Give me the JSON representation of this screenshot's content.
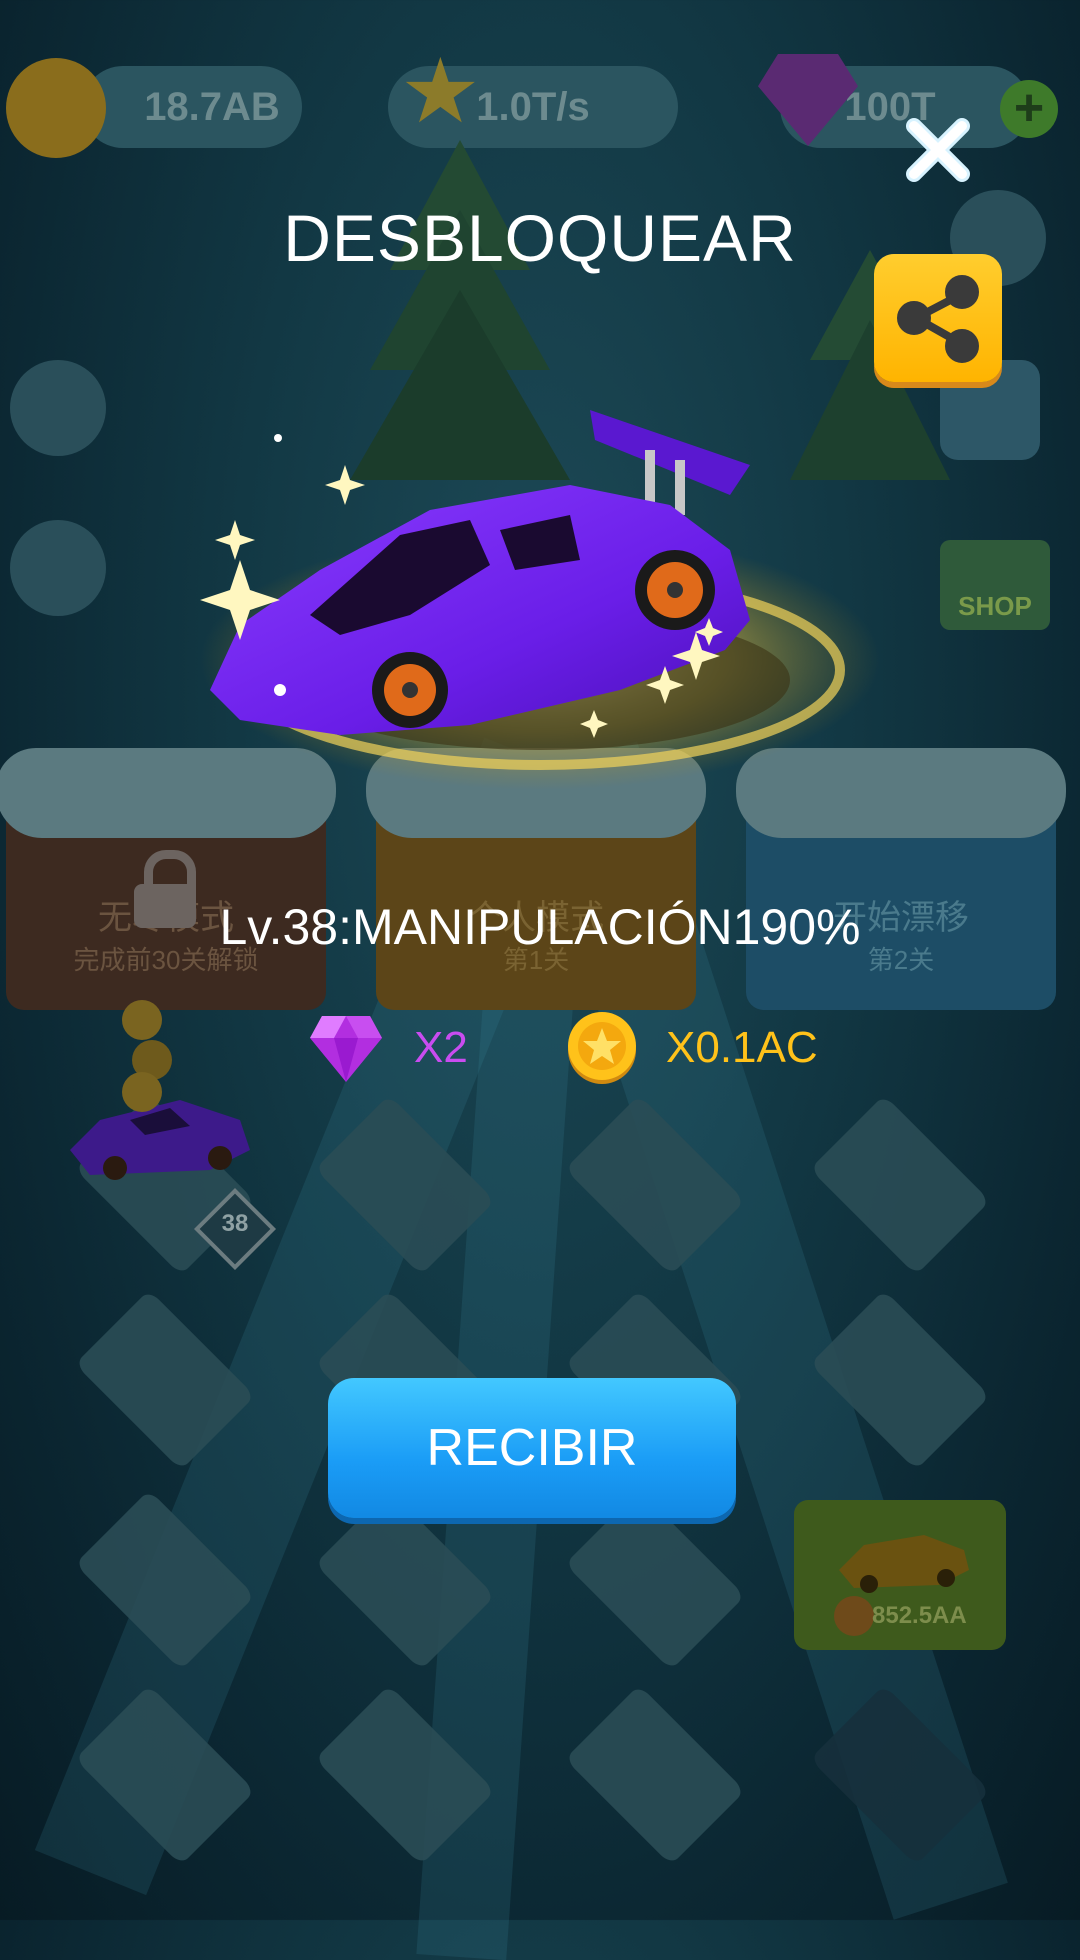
{
  "hud": {
    "coins": "18.7AB",
    "income": "1.0T/s",
    "gems": "100T"
  },
  "background": {
    "mode_cards": [
      {
        "title": "无尽模式",
        "subtitle": "完成前30关解锁"
      },
      {
        "title": "个人模式",
        "subtitle": "第1关"
      },
      {
        "title": "开始漂移",
        "subtitle": "第2关"
      }
    ],
    "shop_label": "SHOP",
    "car_level_badge": "38",
    "buy_price": "852.5AA"
  },
  "popup": {
    "title": "DESBLOQUEAR",
    "level_text": "Lv.38:MANIPULACIÓN190%",
    "gem_reward": "X2",
    "coin_reward": "X0.1AC",
    "receive_label": "RECIBIR"
  },
  "colors": {
    "car": "#6a1ee8",
    "gem_text": "#c94cf0",
    "coin_text": "#ffc21a",
    "button": "#1a9cf6",
    "share_button": "#ffbf12"
  },
  "icons": [
    "close-icon",
    "share-icon",
    "gem-icon",
    "coin-icon",
    "lock-icon",
    "car-image"
  ]
}
